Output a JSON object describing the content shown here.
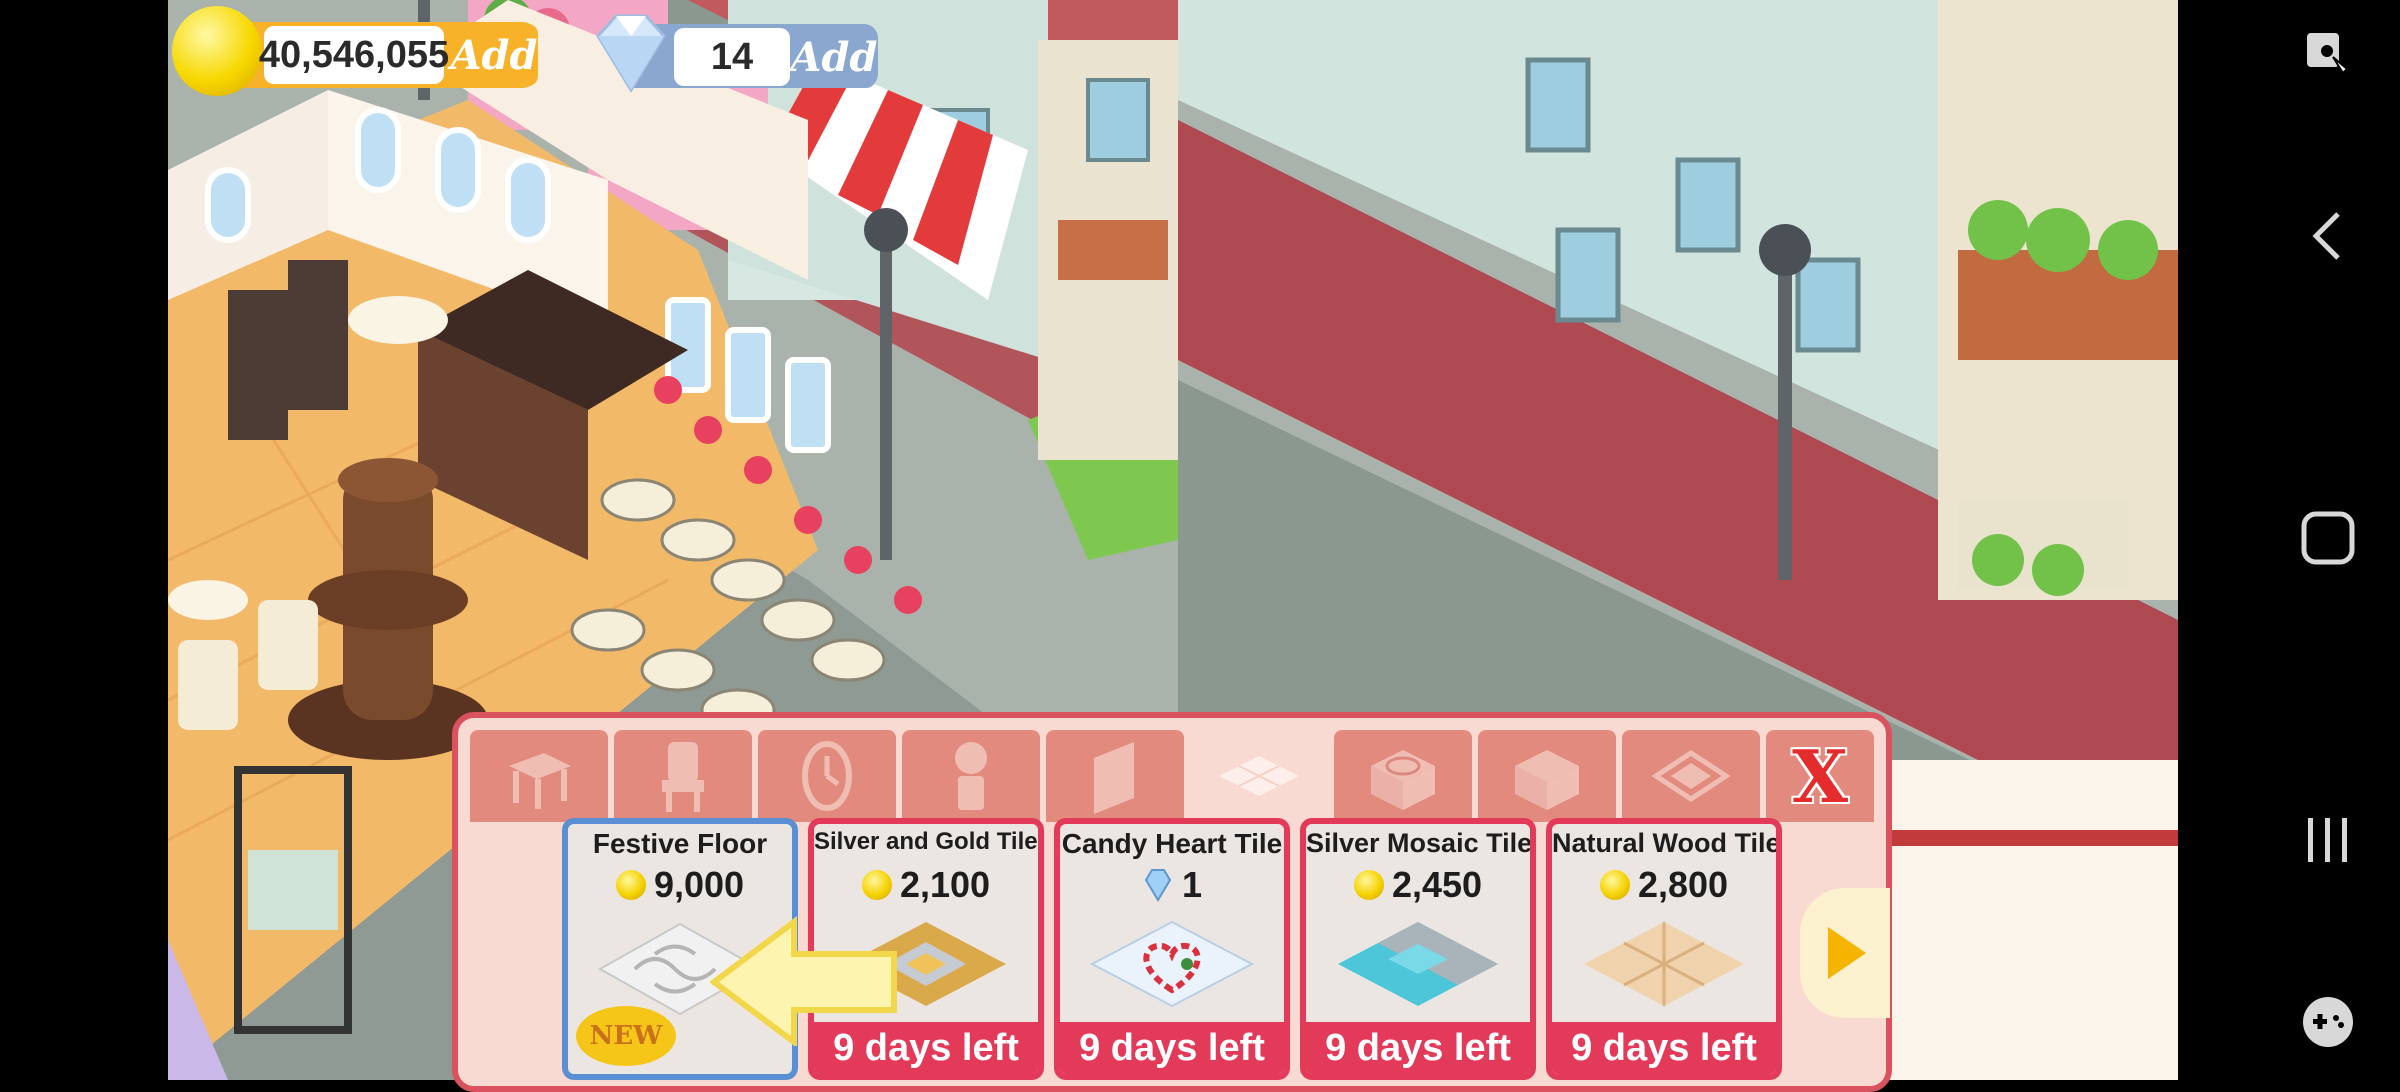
{
  "currency": {
    "coins": "40,546,055",
    "coins_add": "Add",
    "gems": "14",
    "gems_add": "Add"
  },
  "shop": {
    "tabs": [
      "table-icon",
      "chair-icon",
      "clock-icon",
      "plant-icon",
      "wall-icon",
      "floor-icon",
      "stove-icon",
      "counter-icon",
      "expand-icon"
    ],
    "close_label": "X",
    "items": [
      {
        "name": "Festive Floor",
        "price": "9,000",
        "currency": "coin",
        "badge": "NEW"
      },
      {
        "name": "Silver and Gold Tiles",
        "price": "2,100",
        "currency": "coin",
        "days_left": "9 days left"
      },
      {
        "name": "Candy Heart Tile",
        "price": "1",
        "currency": "gem",
        "days_left": "9 days left"
      },
      {
        "name": "Silver Mosaic Tile",
        "price": "2,450",
        "currency": "coin",
        "days_left": "9 days left"
      },
      {
        "name": "Natural Wood Tile",
        "price": "2,800",
        "currency": "coin",
        "days_left": "9 days left"
      }
    ]
  },
  "colors": {
    "panel_border": "#d9525d",
    "panel_bg": "#f9dad2",
    "limited_red": "#e43a5a",
    "selected_blue": "#5b8fd4"
  }
}
